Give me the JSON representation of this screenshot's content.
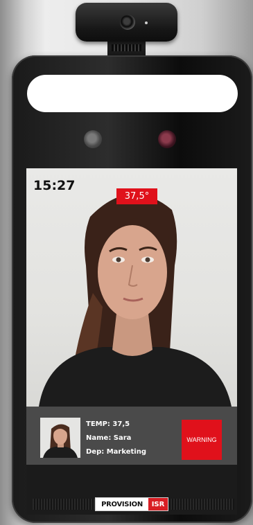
{
  "screen": {
    "time": "15:27",
    "temperature_badge": "37,5°"
  },
  "info": {
    "temp": "TEMP: 37,5",
    "name": "Name: Sara",
    "department": "Dep: Marketing",
    "status": "WARNING"
  },
  "brand": {
    "main": "PROVISION",
    "suffix": "ISR"
  },
  "colors": {
    "alert": "#e0111b",
    "brand_red": "#d81e24"
  }
}
